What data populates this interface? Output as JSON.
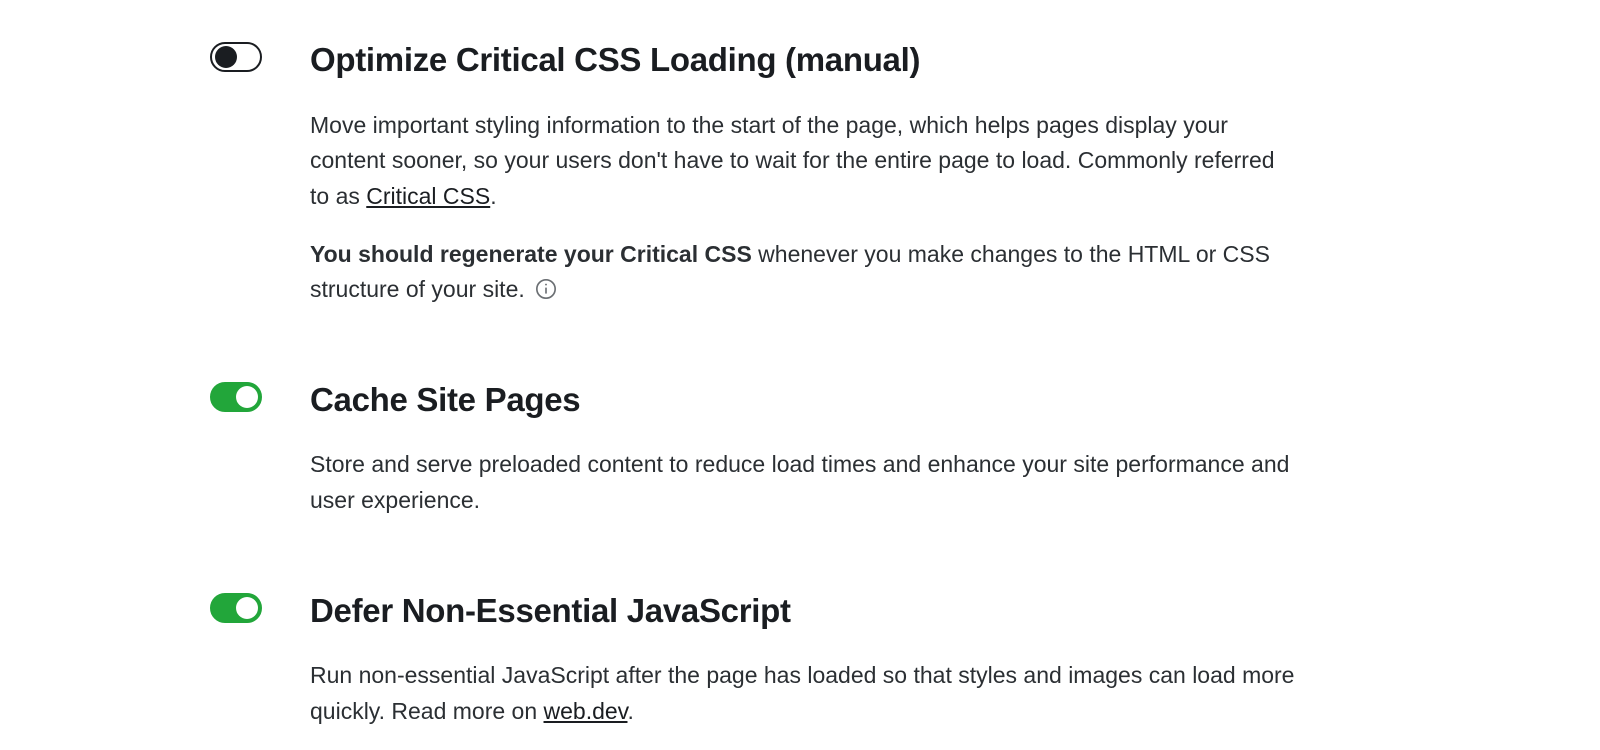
{
  "settings": [
    {
      "id": "critical-css",
      "enabled": false,
      "title": "Optimize Critical CSS Loading (manual)",
      "desc1_pre": "Move important styling information to the start of the page, which helps pages display your content sooner, so your users don't have to wait for the entire page to load. Commonly referred to as ",
      "desc1_link": "Critical CSS",
      "desc1_post": ".",
      "note_bold": "You should regenerate your Critical CSS",
      "note_rest": " whenever you make changes to the HTML or CSS structure of your site.  "
    },
    {
      "id": "cache-pages",
      "enabled": true,
      "title": "Cache Site Pages",
      "desc": "Store and serve preloaded content to reduce load times and enhance your site performance and user experience."
    },
    {
      "id": "defer-js",
      "enabled": true,
      "title": "Defer Non-Essential JavaScript",
      "desc_pre": "Run non-essential JavaScript after the page has loaded so that styles and images can load more quickly. Read more on ",
      "desc_link": "web.dev",
      "desc_post": "."
    }
  ]
}
